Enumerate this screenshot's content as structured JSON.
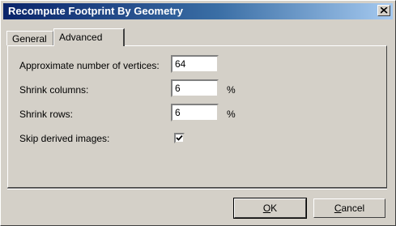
{
  "window": {
    "title": "Recompute Footprint By Geometry"
  },
  "tabs": [
    {
      "label": "General"
    },
    {
      "label": "Advanced"
    }
  ],
  "fields": {
    "vertices": {
      "label": "Approximate number of vertices:",
      "value": "64"
    },
    "shrink_columns": {
      "label": "Shrink columns:",
      "value": "6",
      "unit": "%"
    },
    "shrink_rows": {
      "label": "Shrink rows:",
      "value": "6",
      "unit": "%"
    },
    "skip_derived": {
      "label": "Skip derived images:",
      "checked": true
    }
  },
  "buttons": {
    "ok": {
      "first": "O",
      "rest": "K"
    },
    "cancel": {
      "first": "C",
      "rest": "ancel"
    }
  }
}
